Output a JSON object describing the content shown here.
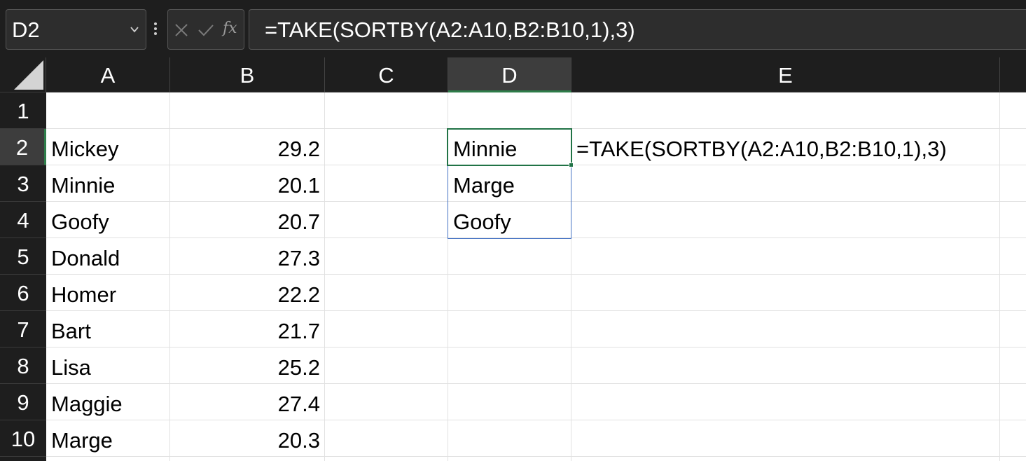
{
  "name_box": {
    "value": "D2"
  },
  "formula_bar": {
    "fx_label": "fx",
    "formula": "=TAKE(SORTBY(A2:A10,B2:B10,1),3)"
  },
  "columns": [
    "A",
    "B",
    "C",
    "D",
    "E"
  ],
  "rows": [
    "1",
    "2",
    "3",
    "4",
    "5",
    "6",
    "7",
    "8",
    "9",
    "10"
  ],
  "selected": {
    "column": "D",
    "row": "2"
  },
  "sheet": {
    "names": [
      "Mickey",
      "Minnie",
      "Goofy",
      "Donald",
      "Homer",
      "Bart",
      "Lisa",
      "Maggie",
      "Marge"
    ],
    "values": [
      "29.2",
      "20.1",
      "20.7",
      "27.3",
      "22.2",
      "21.7",
      "25.2",
      "27.4",
      "20.3"
    ],
    "spill_results": [
      "Minnie",
      "Marge",
      "Goofy"
    ],
    "e2_text": "=TAKE(SORTBY(A2:A10,B2:B10,1),3)"
  },
  "colors": {
    "header_bg": "#1e1e1e",
    "selected_header_bg": "#3d3d3d",
    "active_cell_border": "#217346",
    "spill_border": "#4472c4",
    "gridline": "#e1e1e1"
  }
}
